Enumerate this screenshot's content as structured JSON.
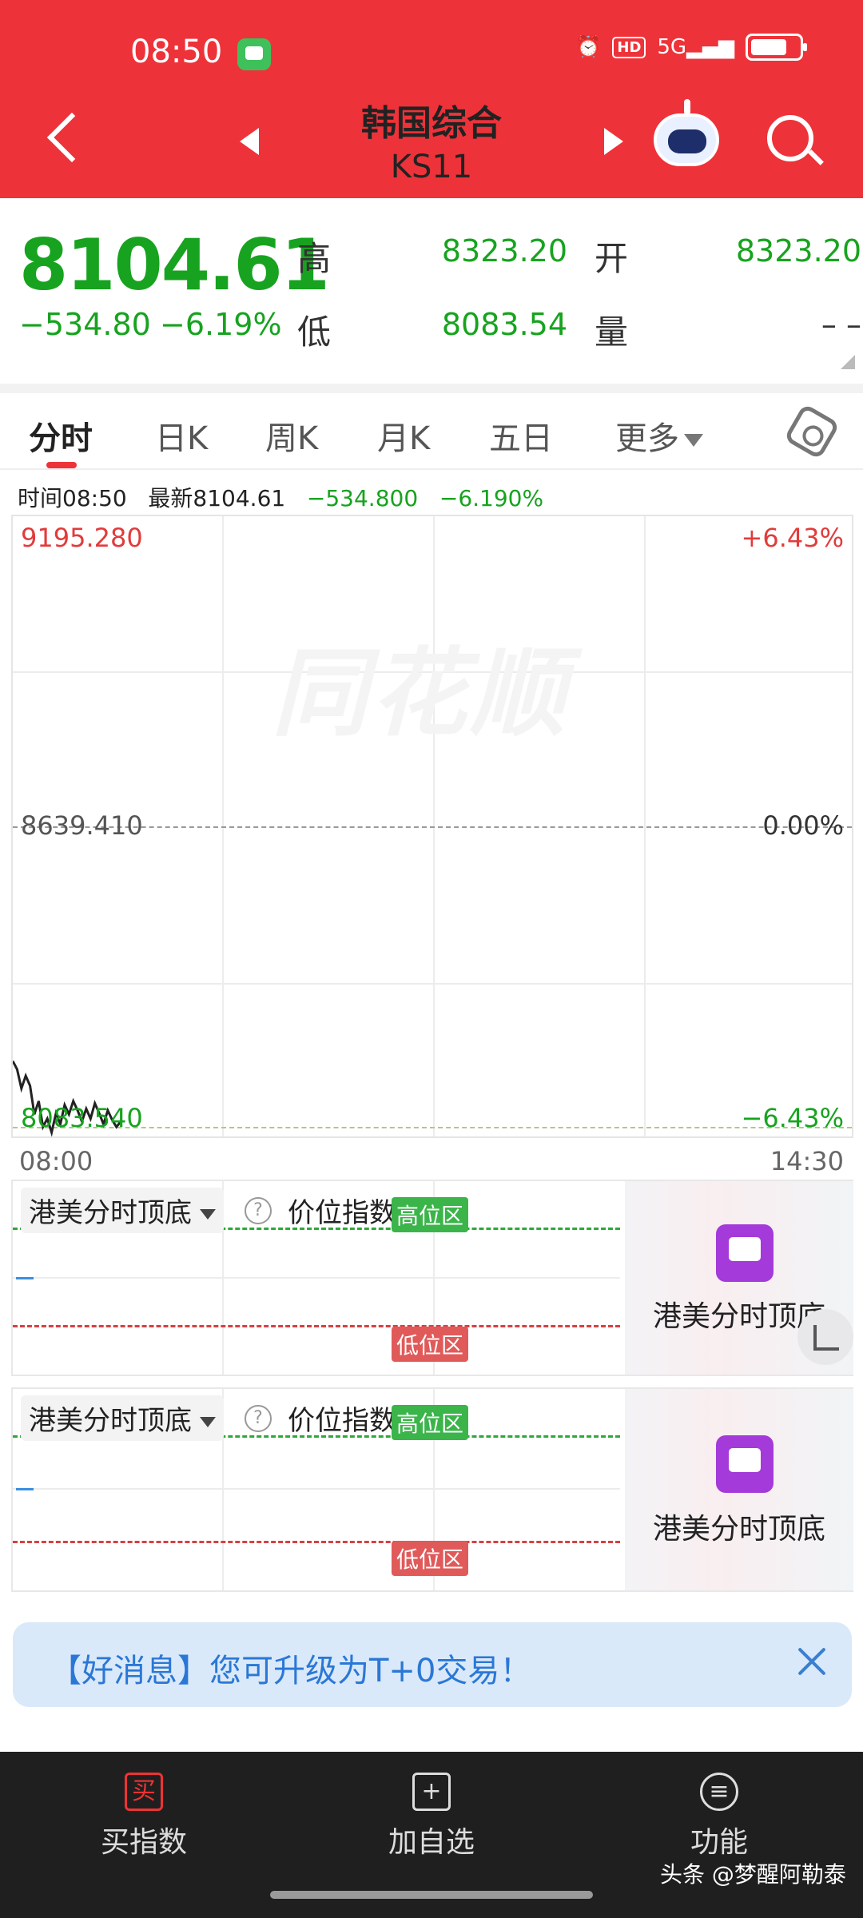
{
  "status_bar": {
    "time": "08:50",
    "right_icons": [
      "alarm-icon",
      "hd-icon",
      "5g-signal-icon",
      "battery-icon"
    ],
    "hd_label": "HD",
    "signal_label": "5G"
  },
  "header": {
    "title": "韩国综合",
    "code": "KS11",
    "bg_color": "#ee3239"
  },
  "quote": {
    "price": "8104.61",
    "change": "−534.80",
    "change_pct": "−6.19%",
    "high_label": "高",
    "high": "8323.20",
    "low_label": "低",
    "low": "8083.54",
    "open_label": "开",
    "open": "8323.20",
    "volume_label": "量",
    "volume": "– –"
  },
  "tabs": [
    {
      "label": "分时"
    },
    {
      "label": "日K"
    },
    {
      "label": "周K"
    },
    {
      "label": "月K"
    },
    {
      "label": "五日"
    },
    {
      "label": "更多"
    }
  ],
  "info_line": {
    "time": "时间08:50",
    "latest": "最新8104.61",
    "change": "−534.800",
    "change_pct": "−6.190%"
  },
  "chart": {
    "watermark": "同花顺",
    "y_top": "9195.280",
    "y_mid": "8639.410",
    "y_bottom": "8083.540",
    "pct_top": "+6.43%",
    "pct_mid": "0.00%",
    "pct_bottom": "−6.43%",
    "x_start": "08:00",
    "x_end": "14:30"
  },
  "chart_data": {
    "type": "line",
    "ylim": [
      8083.54,
      9195.28
    ],
    "xlim": [
      "08:00",
      "14:30"
    ],
    "reference": 8639.41,
    "x": [
      "08:00",
      "08:02",
      "08:04",
      "08:06",
      "08:08",
      "08:10",
      "08:12",
      "08:14",
      "08:16",
      "08:18",
      "08:20",
      "08:22",
      "08:24",
      "08:26",
      "08:28",
      "08:30",
      "08:32",
      "08:34",
      "08:36",
      "08:38",
      "08:40",
      "08:42",
      "08:44",
      "08:46",
      "08:48",
      "08:50"
    ],
    "series": [
      {
        "values": [
          8215,
          8200,
          8165,
          8188,
          8170,
          8118,
          8142,
          8095,
          8110,
          8085,
          8120,
          8100,
          8135,
          8118,
          8142,
          8125,
          8105,
          8128,
          8110,
          8138,
          8120,
          8100,
          8125,
          8108,
          8095,
          8104.61
        ]
      }
    ],
    "grid": true
  },
  "indicators": [
    {
      "name": "港美分时顶底",
      "sub_name": "价位指数",
      "high_zone": "高位区",
      "low_zone": "低位区",
      "side_label": "港美分时顶底"
    },
    {
      "name": "港美分时顶底",
      "sub_name": "价位指数",
      "high_zone": "高位区",
      "low_zone": "低位区",
      "side_label": "港美分时顶底"
    }
  ],
  "banner": {
    "text": "【好消息】您可升级为T+0交易！"
  },
  "bottom_nav": [
    {
      "label": "买指数",
      "icon": "买"
    },
    {
      "label": "加自选",
      "icon": "+"
    },
    {
      "label": "功能",
      "icon": "≡"
    }
  ],
  "credit": "头条 @梦醒阿勒泰",
  "colors": {
    "up": "#e23b3b",
    "down": "#17a31f",
    "accent": "#ee3239"
  }
}
